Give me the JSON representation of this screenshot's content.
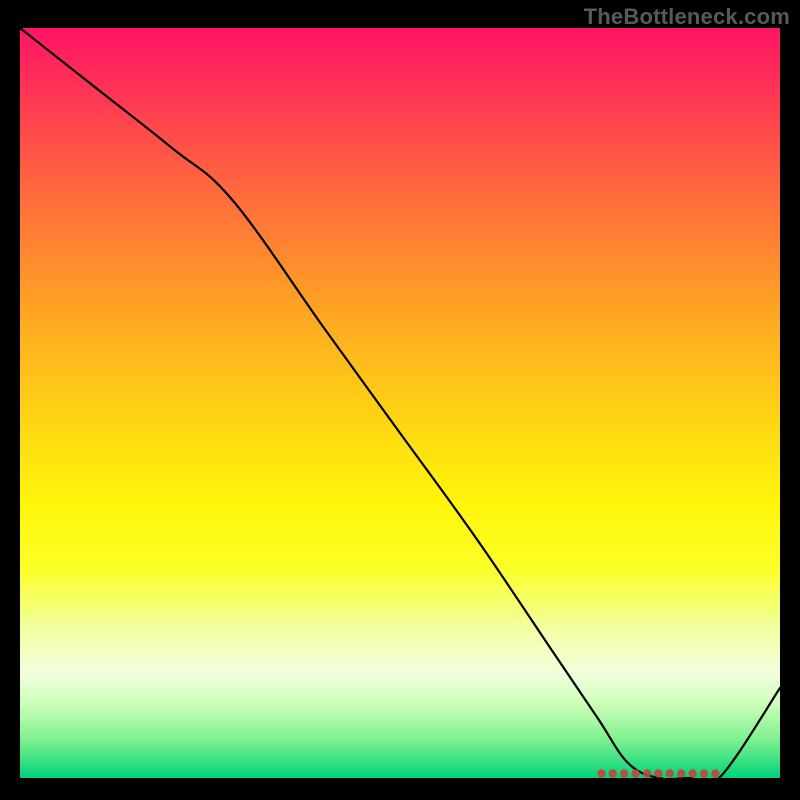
{
  "watermark": "TheBottleneck.com",
  "chart_data": {
    "type": "line",
    "title": "",
    "xlabel": "",
    "ylabel": "",
    "xlim": [
      0,
      100
    ],
    "ylim": [
      0,
      100
    ],
    "grid": false,
    "legend": false,
    "series": [
      {
        "name": "bottleneck-curve",
        "x": [
          0,
          10,
          20,
          28,
          40,
          50,
          60,
          70,
          76,
          80,
          84,
          88,
          92,
          100
        ],
        "y": [
          100,
          92,
          84,
          77,
          60,
          46,
          32,
          17,
          8,
          2,
          0,
          0,
          0,
          12
        ],
        "is_line_path": true
      },
      {
        "name": "optimal-range-markers",
        "x": [
          76.5,
          78.0,
          79.5,
          81.0,
          82.5,
          84.0,
          85.5,
          87.0,
          88.5,
          90.0,
          91.5
        ],
        "y": [
          0.6,
          0.6,
          0.6,
          0.6,
          0.6,
          0.6,
          0.6,
          0.6,
          0.6,
          0.6,
          0.6
        ],
        "is_marker_points": true
      }
    ],
    "colors": {
      "line": "#000000",
      "markers": "#c9413e",
      "gradient_top": "#ff1464",
      "gradient_bottom": "#00d27a"
    }
  }
}
